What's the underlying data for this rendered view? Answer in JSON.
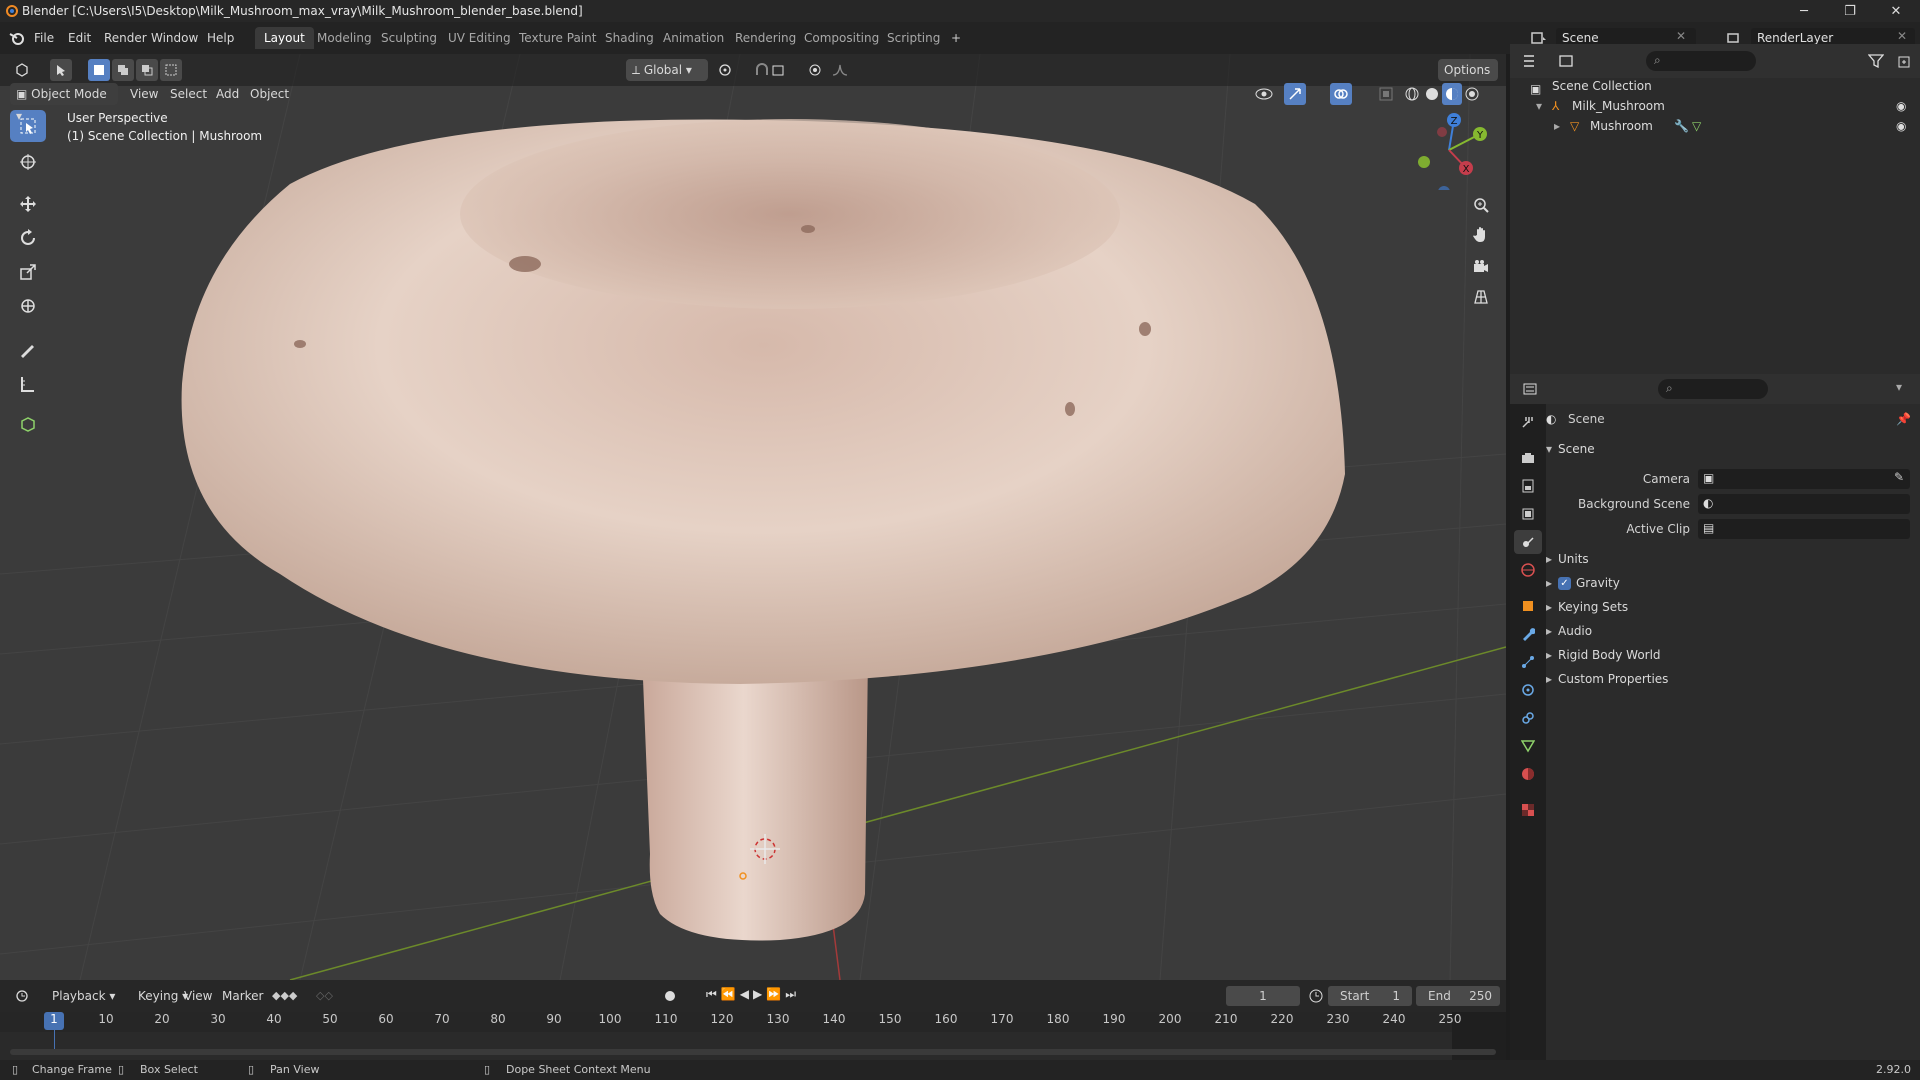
{
  "window": {
    "title": "Blender [C:\\Users\\I5\\Desktop\\Milk_Mushroom_max_vray\\Milk_Mushroom_blender_base.blend]",
    "minimize": "─",
    "maximize": "❐",
    "close": "✕"
  },
  "menu": [
    "File",
    "Edit",
    "Render",
    "Window",
    "Help"
  ],
  "workspaces": [
    "Layout",
    "Modeling",
    "Sculpting",
    "UV Editing",
    "Texture Paint",
    "Shading",
    "Animation",
    "Rendering",
    "Compositing",
    "Scripting"
  ],
  "workspace_add": "+",
  "scene_field": "Scene",
  "renderlayer_field": "RenderLayer",
  "viewport": {
    "transform_orientation": "Global",
    "options_label": "Options",
    "mode": "Object Mode",
    "menus": [
      "View",
      "Select",
      "Add",
      "Object"
    ],
    "info_line1": "User Perspective",
    "info_line2": "(1) Scene Collection | Mushroom",
    "gizmo": {
      "z": "Z",
      "y": "Y",
      "x": "X"
    }
  },
  "outliner": {
    "root": "Scene Collection",
    "collection": "Milk_Mushroom",
    "object": "Mushroom"
  },
  "properties": {
    "context": "Scene",
    "panel_title": "Scene",
    "fields": [
      {
        "label": "Camera"
      },
      {
        "label": "Background Scene"
      },
      {
        "label": "Active Clip"
      }
    ],
    "subpanels": [
      "Units",
      "Gravity",
      "Keying Sets",
      "Audio",
      "Rigid Body World",
      "Custom Properties"
    ],
    "gravity_checked": true
  },
  "timeline": {
    "menus": [
      "Playback",
      "Keying",
      "View",
      "Marker"
    ],
    "current_frame": "1",
    "start_label": "Start",
    "start_value": "1",
    "end_label": "End",
    "end_value": "250",
    "ticks": [
      "1",
      "10",
      "20",
      "30",
      "40",
      "50",
      "60",
      "70",
      "80",
      "90",
      "100",
      "110",
      "120",
      "130",
      "140",
      "150",
      "160",
      "170",
      "180",
      "190",
      "200",
      "210",
      "220",
      "230",
      "240",
      "250"
    ]
  },
  "status": {
    "change_frame": "Change Frame",
    "box_select": "Box Select",
    "pan_view": "Pan View",
    "context_menu": "Dope Sheet Context Menu",
    "version": "2.92.0"
  },
  "colors": {
    "accent": "#4772b3",
    "active_tool": "#5680c2",
    "axis_x": "#c53d4c",
    "axis_y": "#86b930",
    "axis_z": "#3f7fd8"
  }
}
